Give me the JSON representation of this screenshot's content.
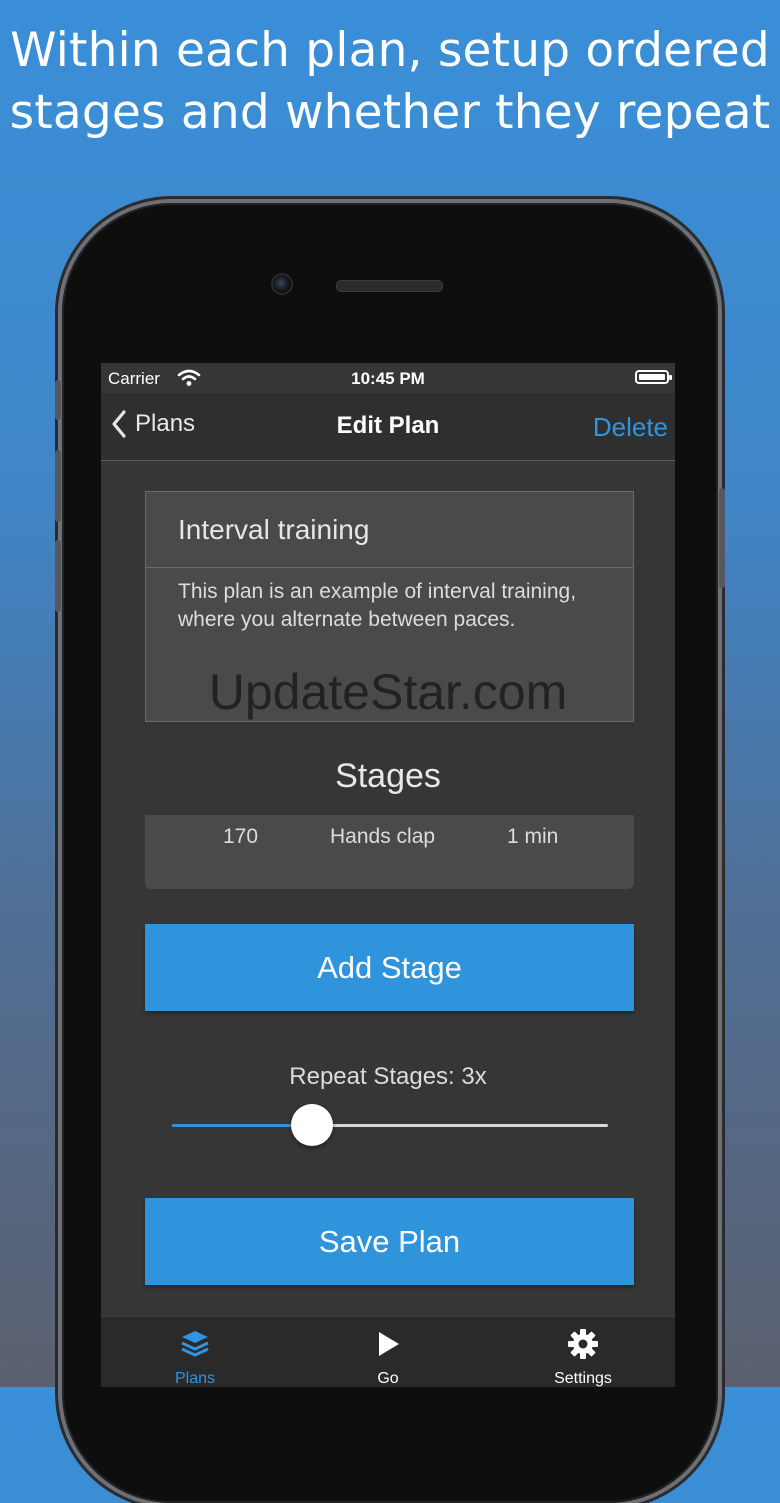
{
  "headline": {
    "line1": "Within each plan, setup ordered",
    "line2": "stages and whether they repeat"
  },
  "status_bar": {
    "carrier": "Carrier",
    "time": "10:45 PM"
  },
  "nav_bar": {
    "back_label": "Plans",
    "title": "Edit Plan",
    "delete_label": "Delete"
  },
  "plan": {
    "name": "Interval training",
    "description": "This plan is an example of interval training, where you alternate between paces."
  },
  "watermark": "UpdateStar.com",
  "stages": {
    "title": "Stages",
    "rows": [
      {
        "bpm": "170",
        "sound": "Hands clap",
        "duration": "1 min"
      }
    ]
  },
  "buttons": {
    "add_stage": "Add Stage",
    "save_plan": "Save Plan"
  },
  "repeat": {
    "label": "Repeat Stages: 3x",
    "slider_fraction": 0.32
  },
  "tab_bar": {
    "items": [
      {
        "label": "Plans",
        "icon": "layers-icon",
        "active": true
      },
      {
        "label": "Go",
        "icon": "play-icon",
        "active": false
      },
      {
        "label": "Settings",
        "icon": "gear-icon",
        "active": false
      }
    ]
  },
  "colors": {
    "accent": "#2f94dc",
    "background_top": "#3a8fd8",
    "screen_bg": "#363636",
    "tab_active": "#2e95e0",
    "tab_inactive": "#ffffff"
  }
}
